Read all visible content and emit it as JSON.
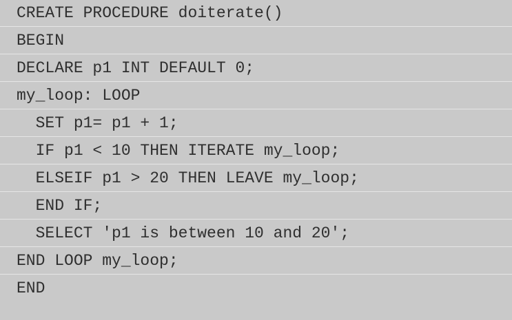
{
  "code": {
    "lines": [
      "CREATE PROCEDURE doiterate()",
      "BEGIN",
      "DECLARE p1 INT DEFAULT 0;",
      "my_loop: LOOP",
      "  SET p1= p1 + 1;",
      "  IF p1 < 10 THEN ITERATE my_loop;",
      "  ELSEIF p1 > 20 THEN LEAVE my_loop;",
      "  END IF;",
      "  SELECT 'p1 is between 10 and 20';",
      "END LOOP my_loop;",
      "END"
    ]
  },
  "colors": {
    "background": "#c9c9c9",
    "divider": "#e6e6e6",
    "text": "#2f2f2f"
  }
}
